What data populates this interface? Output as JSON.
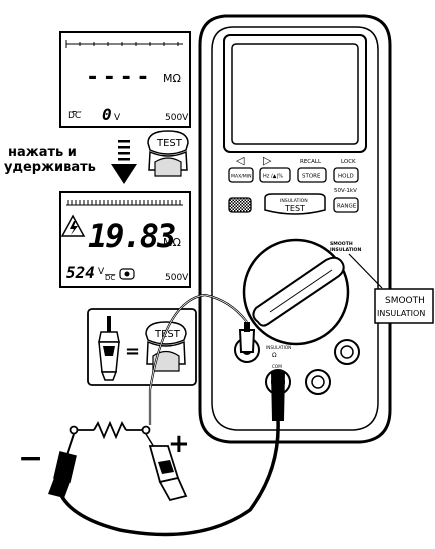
{
  "lcd_top": {
    "dashes": "- - - -",
    "unit": "MΩ",
    "dc": "DC",
    "voltage_value": "0",
    "voltage_unit": "V",
    "range": "500V"
  },
  "instruction": {
    "line1": "нажать и",
    "line2": "удерживать"
  },
  "test_button_label": "TEST",
  "lcd_bottom": {
    "resistance": "19.83",
    "unit": "MΩ",
    "voltage_value": "524",
    "voltage_unit": "V",
    "dc": "DC",
    "range": "500V"
  },
  "meter": {
    "arrow_left": "◁",
    "arrow_right": "▷",
    "recall": "RECALL",
    "lock": "LOCK",
    "btn_maxmin": "MAX/MIN",
    "btn_hz": "Hz /▲|%",
    "btn_store": "STORE",
    "btn_hold": "HOLD",
    "volt_range": "50V-1kV",
    "btn_range": "RANGE",
    "insulation_line1": "INSULATION",
    "insulation_line2": "TEST",
    "dial_line1": "SMOOTH",
    "dial_line2": "INSULATION",
    "jack_label_line1": "INSULATION",
    "jack_label_line2": "Ω",
    "jack_com": "COM"
  },
  "callout": {
    "line1": "SMOOTH",
    "line2": "INSULATION"
  },
  "probe_inset": {
    "equals": "=",
    "button_label": "TEST"
  },
  "polarity": {
    "minus": "−",
    "plus": "+"
  }
}
